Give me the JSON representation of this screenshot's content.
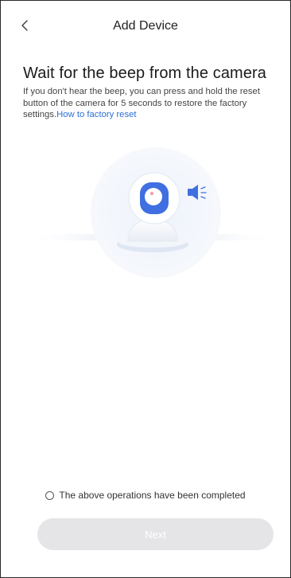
{
  "header": {
    "title": "Add Device",
    "back_icon": "chevron-left-icon"
  },
  "content": {
    "heading": "Wait for the beep from the camera",
    "description": "If you don't hear the beep, you can press and hold the reset button of the camera for 5 seconds to restore the factory settings.",
    "link_text": "How to factory reset"
  },
  "illustration": {
    "camera_icon": "camera-icon",
    "speaker_icon": "speaker-icon"
  },
  "footer": {
    "confirm_label": "The above operations have been completed",
    "confirm_checked": false,
    "next_label": "Next",
    "next_enabled": false
  },
  "colors": {
    "link": "#2d6fd6",
    "accent": "#3f6fe0",
    "button_disabled": "#e5e4e7"
  }
}
